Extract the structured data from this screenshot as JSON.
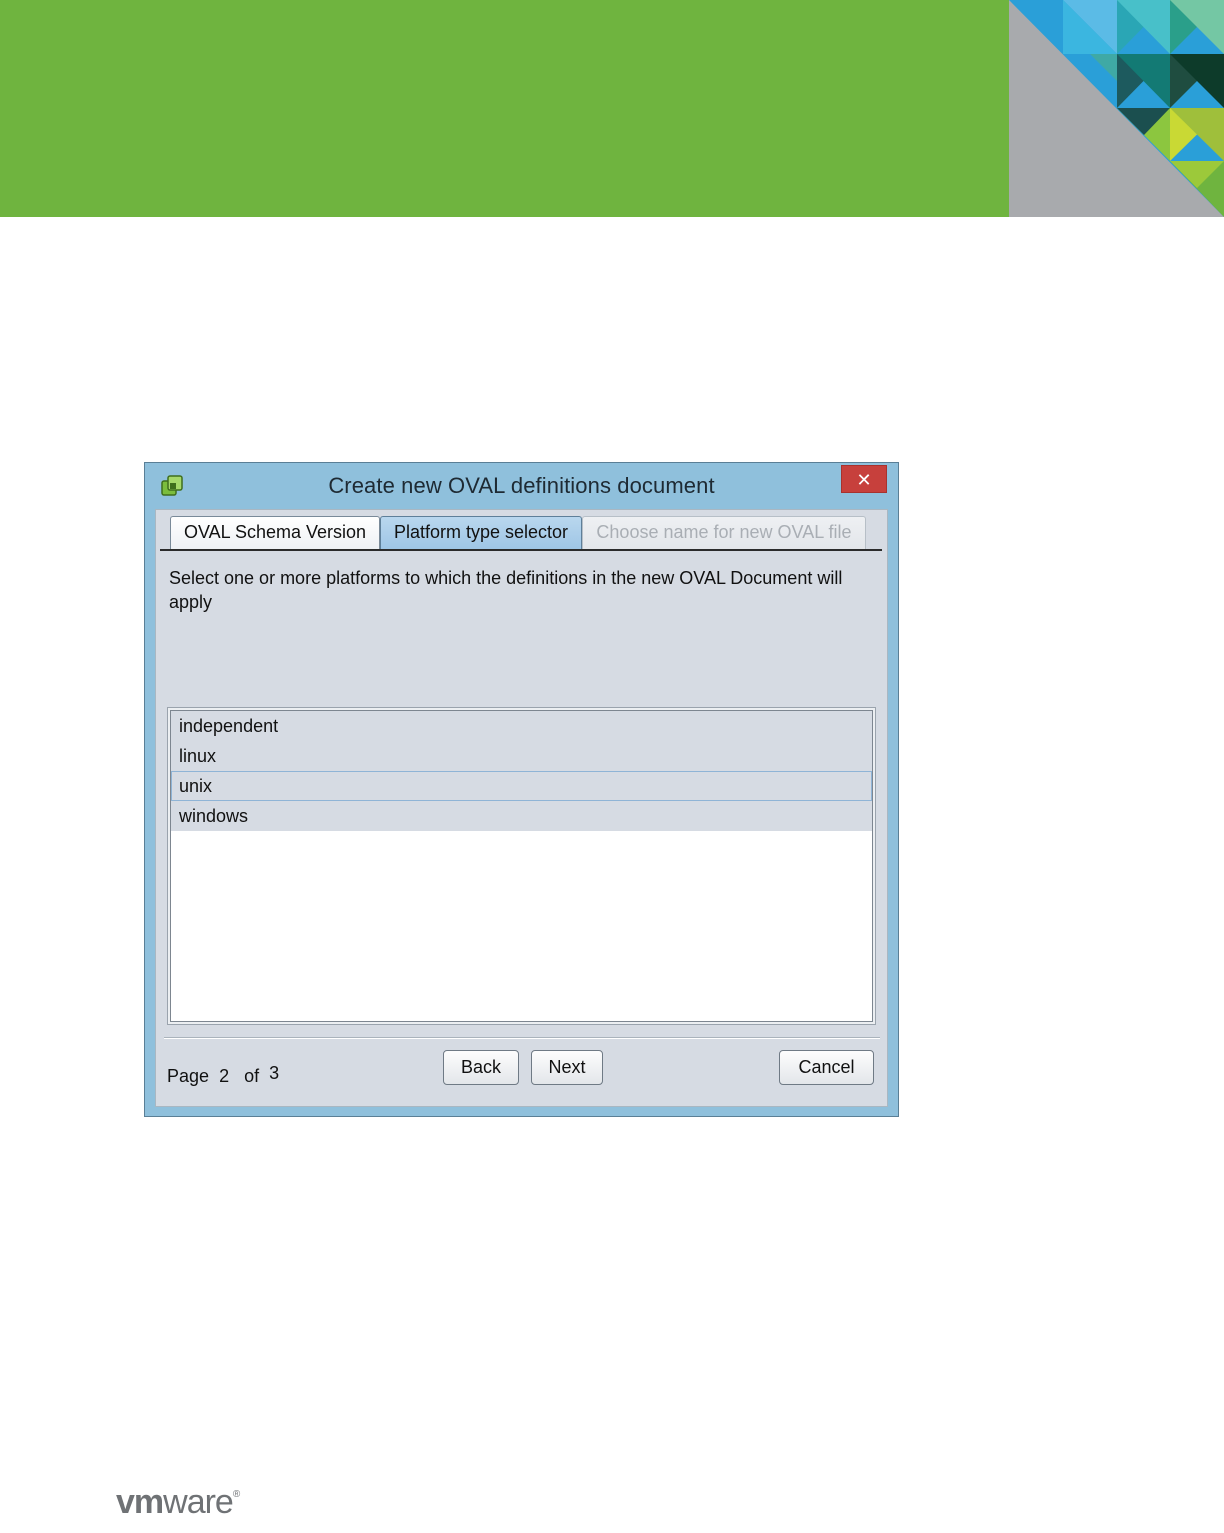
{
  "dialog": {
    "title": "Create new OVAL definitions document",
    "close_glyph": "✕",
    "tabs": [
      {
        "label": "OVAL Schema Version"
      },
      {
        "label": "Platform type selector",
        "active": true
      },
      {
        "label": "Choose name for new OVAL file",
        "disabled": true
      }
    ],
    "instruction": "Select one or more platforms to which the definitions in the new OVAL Document will apply",
    "platforms": [
      {
        "label": "independent"
      },
      {
        "label": "linux"
      },
      {
        "label": "unix",
        "focused": true
      },
      {
        "label": "windows"
      }
    ],
    "pager": {
      "page_label": "Page",
      "current": "2",
      "of_label": "of",
      "total": "3"
    },
    "buttons": {
      "back": "Back",
      "next": "Next",
      "cancel": "Cancel"
    }
  },
  "footer": {
    "logo_bold": "vm",
    "logo_light": "ware",
    "logo_mark": "®"
  },
  "colors": {
    "banner_green": "#6fb43f",
    "title_bar": "#8fc0dc",
    "close_red": "#c7403c",
    "dialog_body": "#d6dbe3"
  },
  "icons": {
    "app": "app-window-icon",
    "close": "close-icon"
  }
}
